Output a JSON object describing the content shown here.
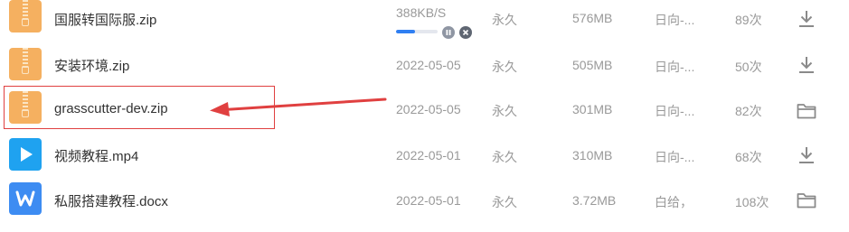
{
  "files": [
    {
      "name": "国服转国际服.zip",
      "type": "zip",
      "status": "downloading",
      "speed": "388KB/S",
      "progress_percent": 45,
      "permission": "永久",
      "size": "576MB",
      "shared_to": "日向-...",
      "downloads": "89次",
      "action_icon": "download-icon"
    },
    {
      "name": "安装环境.zip",
      "type": "zip",
      "date": "2022-05-05",
      "permission": "永久",
      "size": "505MB",
      "shared_to": "日向-...",
      "downloads": "50次",
      "action_icon": "download-icon"
    },
    {
      "name": "grasscutter-dev.zip",
      "type": "zip",
      "date": "2022-05-05",
      "permission": "永久",
      "size": "301MB",
      "shared_to": "日向-...",
      "downloads": "82次",
      "action_icon": "folder-icon",
      "highlighted": true
    },
    {
      "name": "视频教程.mp4",
      "type": "video",
      "date": "2022-05-01",
      "permission": "永久",
      "size": "310MB",
      "shared_to": "日向-...",
      "downloads": "68次",
      "action_icon": "download-icon"
    },
    {
      "name": "私服搭建教程.docx",
      "type": "word-doc",
      "date": "2022-05-01",
      "permission": "永久",
      "size": "3.72MB",
      "shared_to": "白给，",
      "downloads": "108次",
      "action_icon": "folder-icon"
    }
  ],
  "colors": {
    "zip": "#f5b060",
    "video": "#1fa2f0",
    "doc": "#3d8cf2",
    "accent_progress": "#2f7ff2",
    "annotation_red": "#e04040",
    "muted_text": "#999999"
  },
  "annotation": {
    "type": "arrow-and-box",
    "target_row": 2
  }
}
